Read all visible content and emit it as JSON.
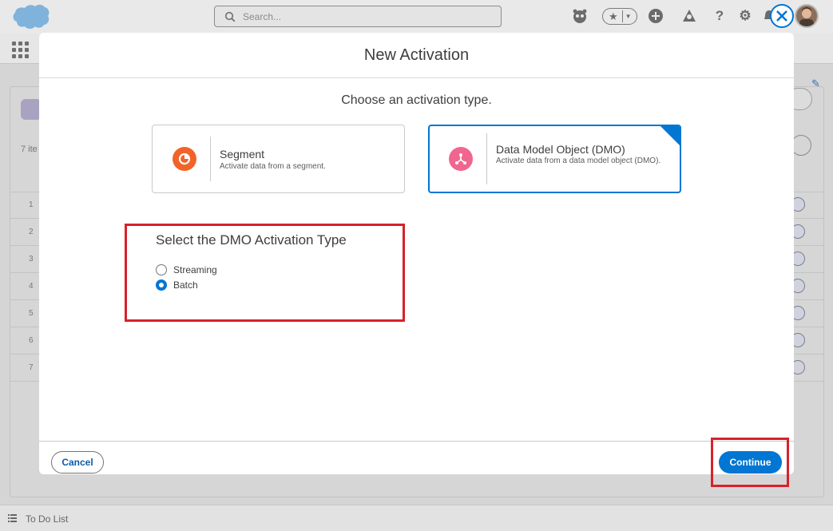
{
  "header": {
    "search_placeholder": "Search..."
  },
  "background": {
    "items_text": "7 ite",
    "row_numbers": [
      "1",
      "2",
      "3",
      "4",
      "5",
      "6",
      "7"
    ],
    "todo_label": "To Do List"
  },
  "modal": {
    "title": "New Activation",
    "prompt": "Choose an activation type.",
    "options": [
      {
        "title": "Segment",
        "description": "Activate data from a segment.",
        "icon": "segment-icon",
        "icon_color": "#f26328",
        "selected": false
      },
      {
        "title": "Data Model Object (DMO)",
        "description": "Activate data from a data model object (DMO).",
        "icon": "data-model-icon",
        "icon_color": "#f0668e",
        "selected": true
      }
    ],
    "dmo_section": {
      "heading": "Select the DMO Activation Type",
      "choices": [
        {
          "label": "Streaming",
          "checked": false
        },
        {
          "label": "Batch",
          "checked": true
        }
      ]
    },
    "footer": {
      "cancel_label": "Cancel",
      "continue_label": "Continue"
    }
  },
  "colors": {
    "brand": "#0176d3",
    "highlight": "#d7212c"
  }
}
